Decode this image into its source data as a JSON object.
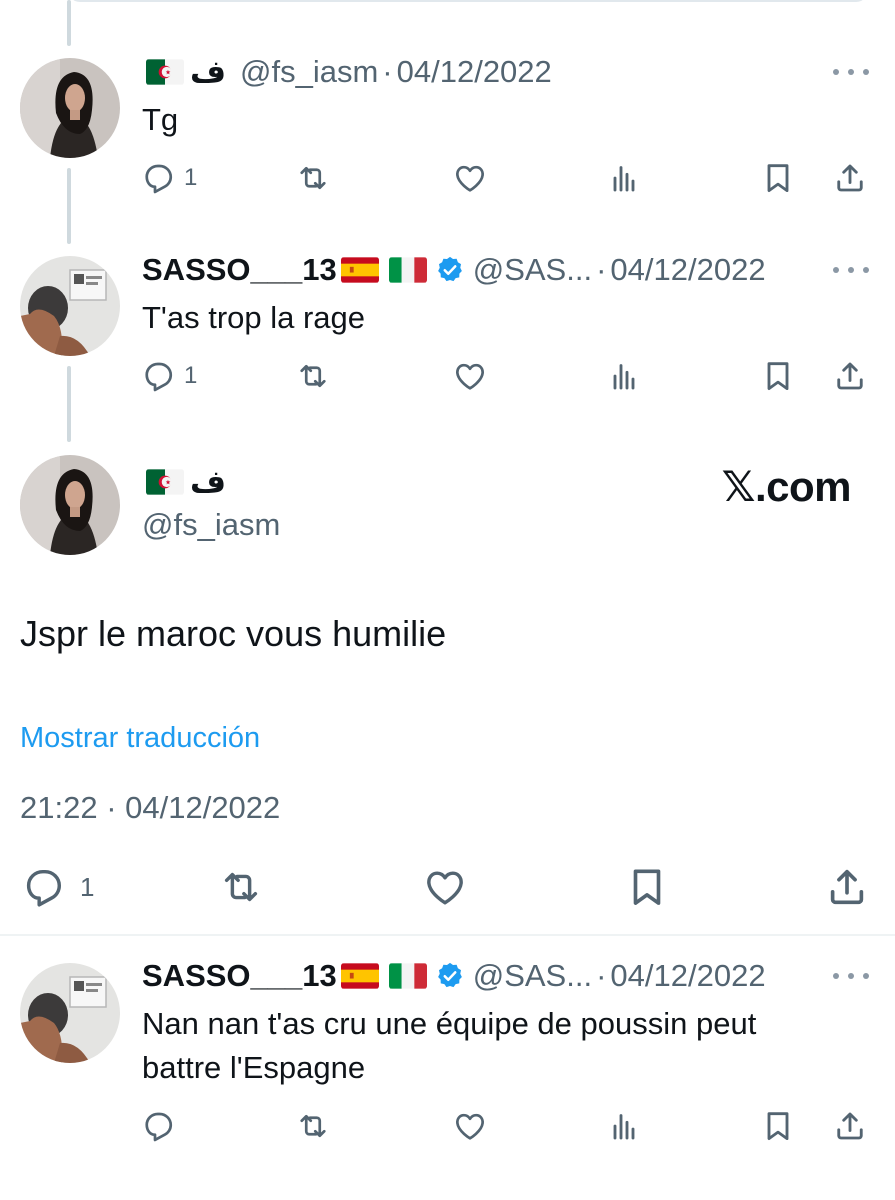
{
  "reply1": {
    "display_name": "ف",
    "handle": "@fs_iasm",
    "separator": "·",
    "date": "04/12/2022",
    "text": "Tg",
    "reply_count": "1"
  },
  "reply2": {
    "display_name": "SASSO___13",
    "handle": "@SAS...",
    "separator": "·",
    "date": "04/12/2022",
    "text": "T'as trop la rage",
    "reply_count": "1"
  },
  "main": {
    "display_name": "ف",
    "handle": "@fs_iasm",
    "watermark": "𝕏.com",
    "text": "Jspr le maroc vous humilie",
    "translate_label": "Mostrar traducción",
    "timestamp": "21:22 · 04/12/2022",
    "reply_count": "1"
  },
  "reply3": {
    "display_name": "SASSO___13",
    "handle": "@SAS...",
    "separator": "·",
    "date": "04/12/2022",
    "text_line1": "Nan nan t'as cru une équipe de poussin peut",
    "text_line2": "battre l'Espagne"
  },
  "icons": {
    "reply": "reply-icon",
    "retweet": "retweet-icon",
    "like": "heart-icon",
    "views": "views-icon",
    "bookmark": "bookmark-icon",
    "share": "share-icon",
    "more": "more-icon",
    "verified": "verified-badge-icon"
  },
  "colors": {
    "text": "#0f1419",
    "secondary": "#536471",
    "link": "#1d9bf0",
    "verified": "#1d9bf0",
    "thread_line": "#cfd9de"
  }
}
